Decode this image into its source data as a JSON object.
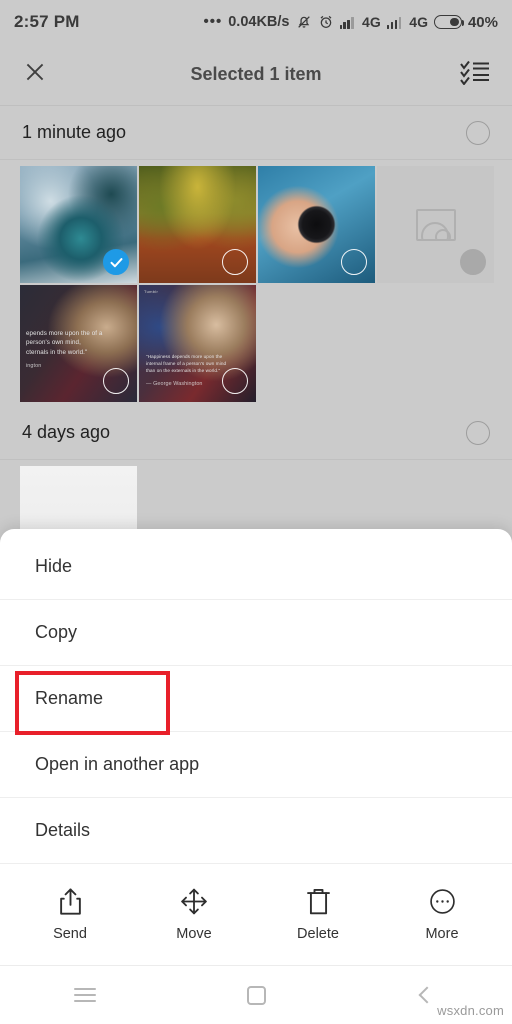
{
  "status_bar": {
    "clock": "2:57 PM",
    "net_speed": "0.04KB/s",
    "dots": "•••",
    "silent_icon": "bell-muted-icon",
    "alarm_icon": "alarm-clock-icon",
    "sim1_label": "4G",
    "sim2_label": "4G",
    "battery_percent": "40%"
  },
  "app_bar": {
    "close_icon": "close-icon",
    "title": "Selected 1 item",
    "select_all_icon": "checklist-icon"
  },
  "sections": [
    {
      "date_label": "1 minute ago",
      "select_circle": "select-circle-icon",
      "photos": [
        {
          "name": "photo-space-statue",
          "selected": true,
          "badge": "checked",
          "art": "art-space"
        },
        {
          "name": "photo-autumn-path",
          "selected": false,
          "badge": "light",
          "art": "art-autumn"
        },
        {
          "name": "photo-camera-lens",
          "selected": false,
          "badge": "light",
          "art": "art-lens"
        },
        {
          "name": "photo-placeholder",
          "selected": false,
          "badge": "solid",
          "art": "placeholder"
        },
        {
          "name": "photo-washington-quote-1",
          "selected": false,
          "badge": "light",
          "art": "art-quote1",
          "overlay": "epends more upon the of a person's own mind, cternals in the world.\"",
          "overlay_attr": "ington"
        },
        {
          "name": "photo-washington-quote-2",
          "selected": false,
          "badge": "light",
          "art": "art-quote2",
          "overlay": "\"Happiness depends more upon the internal frame of a person's own mind than on the externals in the world.\"",
          "overlay_attr": "— George Washington",
          "top_badge": "Tumblr"
        }
      ]
    },
    {
      "date_label": "4 days ago",
      "select_circle": "select-circle-icon",
      "photos": [
        {
          "name": "photo-strawberries",
          "selected": false,
          "badge": "none",
          "art": "art-strawberry"
        }
      ]
    }
  ],
  "sheet": {
    "menu": [
      {
        "name": "menu-item-hide",
        "label": "Hide"
      },
      {
        "name": "menu-item-copy",
        "label": "Copy"
      },
      {
        "name": "menu-item-rename",
        "label": "Rename",
        "highlighted": true
      },
      {
        "name": "menu-item-open-in-another-app",
        "label": "Open in another app"
      },
      {
        "name": "menu-item-details",
        "label": "Details"
      }
    ],
    "highlight_color": "#e8202a",
    "actions": [
      {
        "name": "action-send",
        "label": "Send",
        "icon": "share-upload-icon"
      },
      {
        "name": "action-move",
        "label": "Move",
        "icon": "move-arrows-icon"
      },
      {
        "name": "action-delete",
        "label": "Delete",
        "icon": "trash-icon"
      },
      {
        "name": "action-more",
        "label": "More",
        "icon": "more-circle-icon"
      }
    ]
  },
  "nav_bar": {
    "menu_icon": "hamburger-menu-icon",
    "home_icon": "home-square-icon",
    "back_icon": "back-chevron-icon"
  },
  "watermark": "wsxdn.com",
  "colors": {
    "accent_blue": "#1e9ae6",
    "highlight_red": "#e8202a",
    "chrome_gray": "#cbcbcb",
    "sheet_white": "#ffffff"
  }
}
